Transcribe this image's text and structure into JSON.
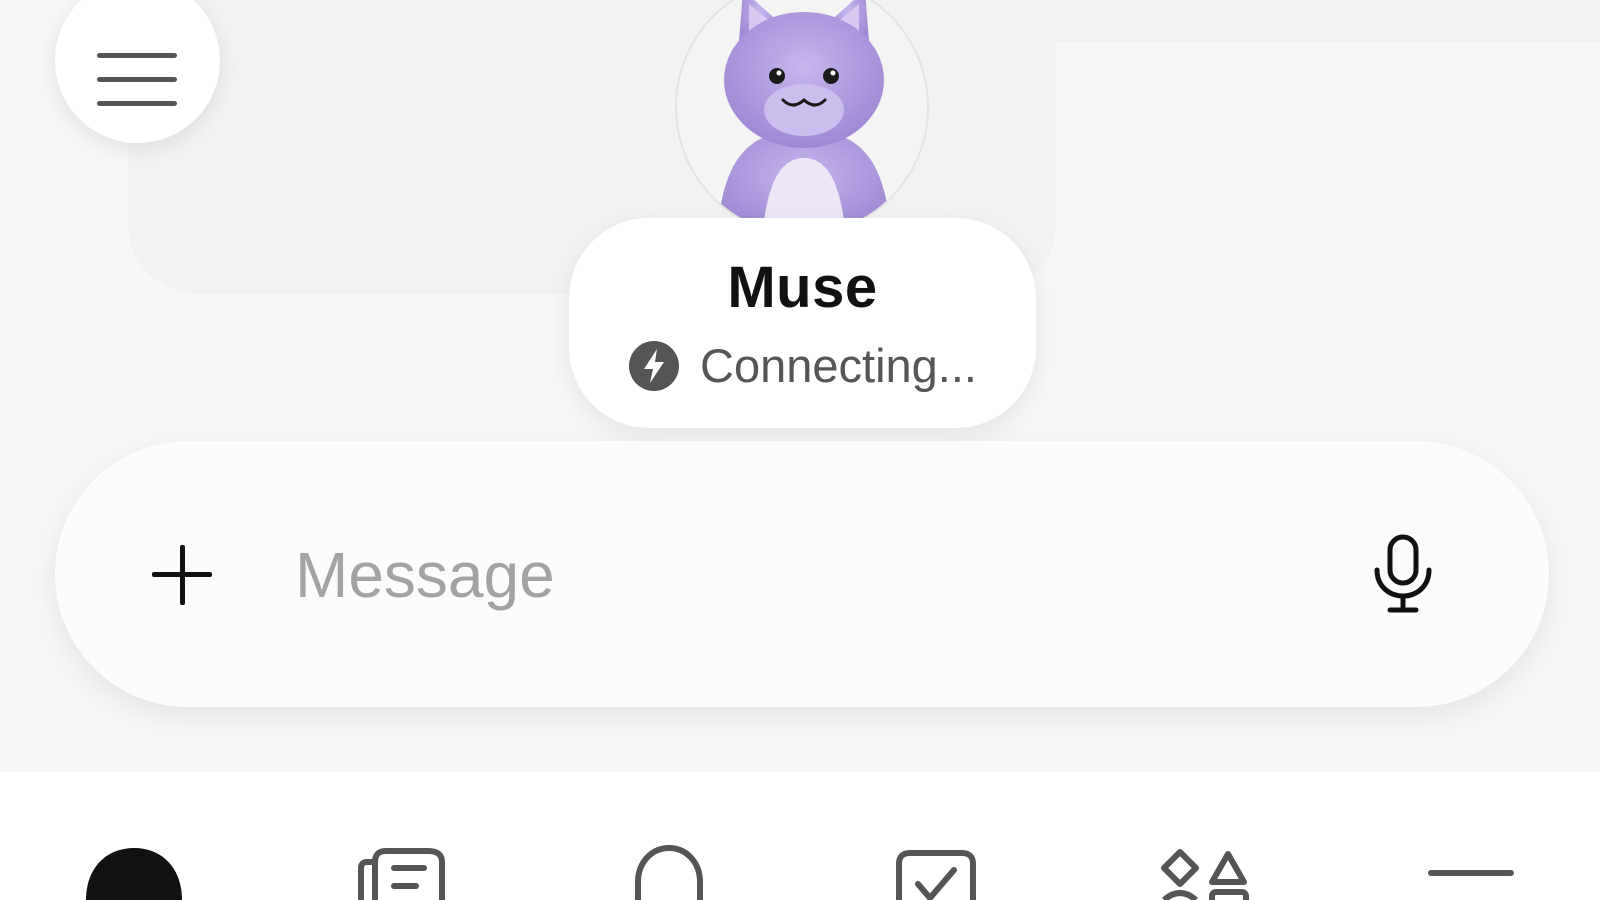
{
  "agent": {
    "name": "Muse",
    "status": "Connecting..."
  },
  "composer": {
    "placeholder": "Message"
  },
  "icons": {
    "menu": "menu-icon",
    "avatar": "cat-avatar",
    "status": "lightning-icon",
    "add": "plus-icon",
    "mic": "microphone-icon",
    "nav": [
      "home-icon",
      "news-icon",
      "chat-icon",
      "tasks-icon",
      "apps-icon",
      "more-icon"
    ]
  },
  "colors": {
    "accent": "#111111",
    "avatar_fur": "#b4a2e0",
    "status_icon": "#555555",
    "placeholder": "#a3a3a3"
  }
}
